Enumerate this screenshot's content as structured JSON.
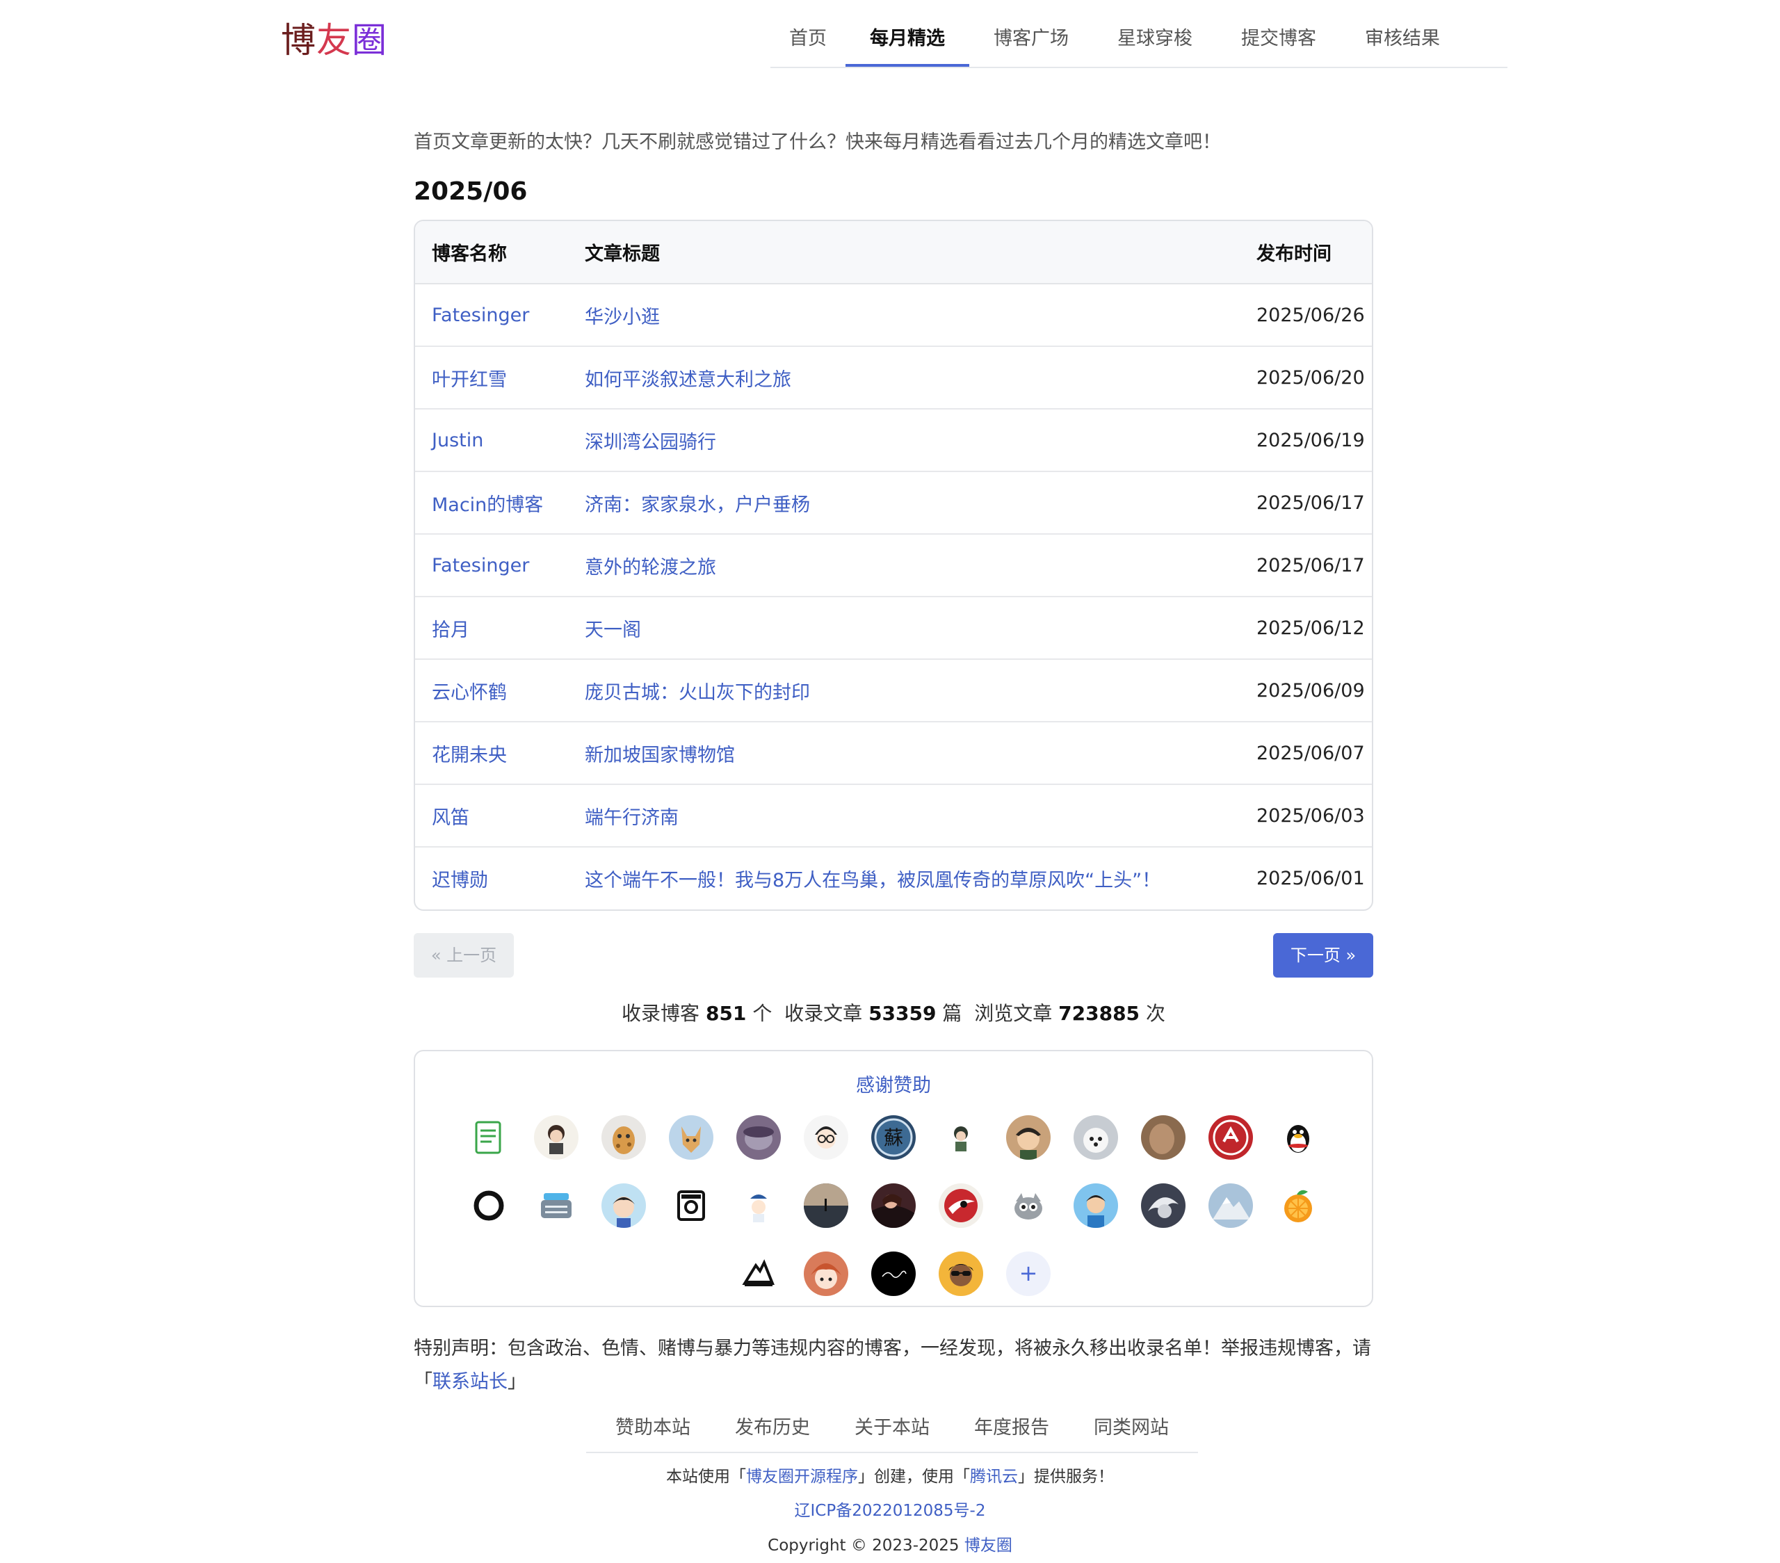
{
  "logo": {
    "c1": "博",
    "c2": "友",
    "c3": "圈"
  },
  "nav": [
    "首页",
    "每月精选",
    "博客广场",
    "星球穿梭",
    "提交博客",
    "审核结果"
  ],
  "intro": "首页文章更新的太快？几天不刷就感觉错过了什么？快来每月精选看看过去几个月的精选文章吧！",
  "month": "2025/06",
  "table": {
    "headers": [
      "博客名称",
      "文章标题",
      "发布时间"
    ],
    "rows": [
      {
        "blog": "Fatesinger",
        "title": "华沙小逛",
        "date": "2025/06/26"
      },
      {
        "blog": "叶开红雪",
        "title": "如何平淡叙述意大利之旅",
        "date": "2025/06/20"
      },
      {
        "blog": "Justin",
        "title": "深圳湾公园骑行",
        "date": "2025/06/19"
      },
      {
        "blog": "Macin的博客",
        "title": "济南：家家泉水，户户垂杨",
        "date": "2025/06/17"
      },
      {
        "blog": "Fatesinger",
        "title": "意外的轮渡之旅",
        "date": "2025/06/17"
      },
      {
        "blog": "拾月",
        "title": "天一阁",
        "date": "2025/06/12"
      },
      {
        "blog": "云心怀鹤",
        "title": "庞贝古城：火山灰下的封印",
        "date": "2025/06/09"
      },
      {
        "blog": "花開未央",
        "title": "新加坡国家博物馆",
        "date": "2025/06/07"
      },
      {
        "blog": "风笛",
        "title": "端午行济南",
        "date": "2025/06/03"
      },
      {
        "blog": "迟博勋",
        "title": "这个端午不一般！我与8万人在鸟巢，被凤凰传奇的草原风吹“上头”！",
        "date": "2025/06/01"
      }
    ]
  },
  "pager": {
    "prev": "« 上一页",
    "next": "下一页 »"
  },
  "stats": {
    "blogs_label": "收录博客",
    "blogs_value": "851",
    "blogs_unit": "个",
    "articles_label": "收录文章",
    "articles_value": "53359",
    "articles_unit": "篇",
    "views_label": "浏览文章",
    "views_value": "723885",
    "views_unit": "次"
  },
  "sponsor": {
    "title": "感谢赞助",
    "plus": "+"
  },
  "notice": {
    "text": "特别声明：包含政治、色情、赌博与暴力等违规内容的博客，一经发现，将被永久移出收录名单！举报违规博客，请「",
    "link": "联系站长",
    "end": "」"
  },
  "footer": {
    "links": [
      "赞助本站",
      "发布历史",
      "关于本站",
      "年度报告",
      "同类网站"
    ],
    "line1_a": "本站使用「",
    "line1_link1": "博友圈开源程序",
    "line1_b": "」创建，使用「",
    "line1_link2": "腾讯云",
    "line1_c": "」提供服务！",
    "icp": "辽ICP备2022012085号-2",
    "copyright": "Copyright © 2023-2025 ",
    "copyright_link": "博友圈"
  },
  "colors": {
    "accent": "#4a68d6",
    "link": "#3f5fc4"
  }
}
